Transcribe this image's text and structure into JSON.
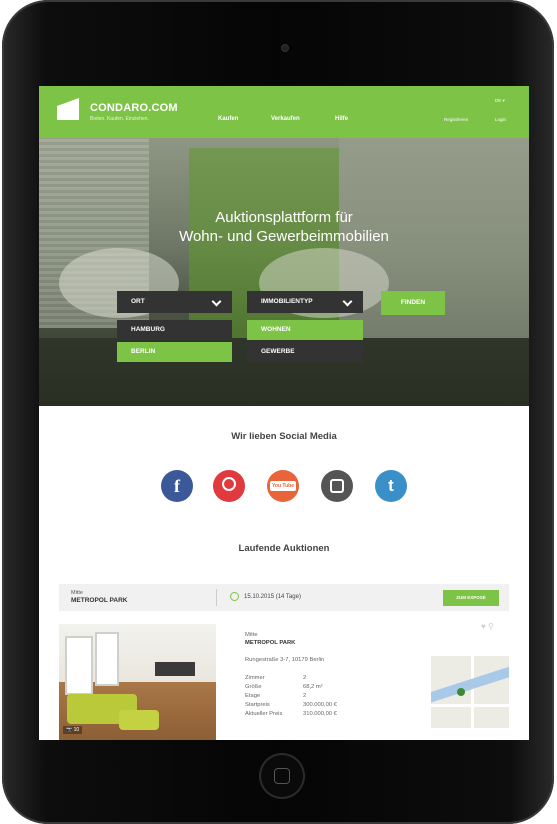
{
  "header": {
    "brand": "CONDARO.COM",
    "tagline": "Bieten. Kaufen. Einziehen.",
    "nav": [
      "Kaufen",
      "Verkaufen",
      "Hilfe"
    ],
    "register": "Registrieren",
    "login": "Login",
    "lang": "DE ▾"
  },
  "hero": {
    "title_line1": "Auktionsplattform für",
    "title_line2": "Wohn- und Gewerbeimmobilien",
    "location_dropdown": "ORT",
    "location_options": [
      "HAMBURG",
      "BERLIN"
    ],
    "type_dropdown": "IMMOBILIENTYP",
    "type_options": [
      "WOHNEN",
      "GEWERBE"
    ],
    "find_button": "FINDEN"
  },
  "social": {
    "title": "Wir lieben Social Media",
    "icons": [
      {
        "name": "facebook-icon",
        "glyph": "f",
        "color": "#3b5998"
      },
      {
        "name": "pinterest-icon",
        "glyph": "p",
        "color": "#e0393e"
      },
      {
        "name": "youtube-icon",
        "glyph": "You Tube",
        "color": "#e8643a"
      },
      {
        "name": "instagram-icon",
        "glyph": "◙",
        "color": "#555555"
      },
      {
        "name": "tumblr-icon",
        "glyph": "t",
        "color": "#3b8fc9"
      }
    ]
  },
  "auctions": {
    "title": "Laufende Auktionen",
    "bar": {
      "district": "Mitte",
      "name": "METROPOL PARK",
      "date": "15.10.2015 (14 Tage)",
      "expose_button": "ZUM EXPOSÉ"
    },
    "photo_count": "10",
    "detail": {
      "district": "Mitte",
      "name": "METROPOL PARK",
      "address": "Rungestraße 3-7, 10179 Berlin",
      "rows": [
        {
          "label": "Zimmer",
          "value": "2"
        },
        {
          "label": "Größe",
          "value": "68,2 m²"
        },
        {
          "label": "Etage",
          "value": "2"
        },
        {
          "label": "Startpreis",
          "value": "300.000,00 €"
        },
        {
          "label": "Aktueller Preis",
          "value": "310.000,00 €"
        }
      ]
    }
  },
  "colors": {
    "accent": "#7dc345",
    "dark_dropdown": "#333333"
  }
}
